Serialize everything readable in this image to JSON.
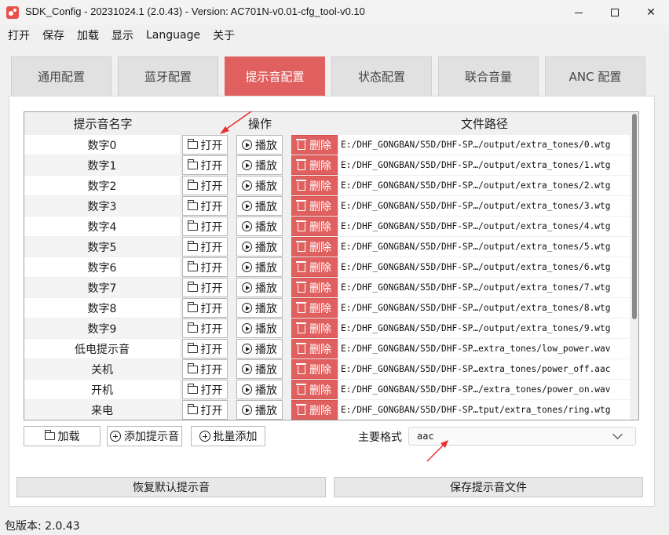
{
  "window": {
    "title": "SDK_Config -  20231024.1  (2.0.43) - Version: AC701N-v0.01-cfg_tool-v0.10"
  },
  "menu": [
    "打开",
    "保存",
    "加载",
    "显示",
    "Language",
    "关于"
  ],
  "tabs": [
    {
      "label": "通用配置",
      "active": false
    },
    {
      "label": "蓝牙配置",
      "active": false
    },
    {
      "label": "提示音配置",
      "active": true
    },
    {
      "label": "状态配置",
      "active": false
    },
    {
      "label": "联合音量",
      "active": false
    },
    {
      "label": "ANC 配置",
      "active": false
    }
  ],
  "table": {
    "headers": {
      "name": "提示音名字",
      "op": "操作",
      "path": "文件路径"
    },
    "open_label": "打开",
    "play_label": "播放",
    "delete_label": "删除",
    "rows": [
      {
        "name": "数字0",
        "path": "E:/DHF_GONGBAN/S5D/DHF-SP…/output/extra_tones/0.wtg"
      },
      {
        "name": "数字1",
        "path": "E:/DHF_GONGBAN/S5D/DHF-SP…/output/extra_tones/1.wtg"
      },
      {
        "name": "数字2",
        "path": "E:/DHF_GONGBAN/S5D/DHF-SP…/output/extra_tones/2.wtg"
      },
      {
        "name": "数字3",
        "path": "E:/DHF_GONGBAN/S5D/DHF-SP…/output/extra_tones/3.wtg"
      },
      {
        "name": "数字4",
        "path": "E:/DHF_GONGBAN/S5D/DHF-SP…/output/extra_tones/4.wtg"
      },
      {
        "name": "数字5",
        "path": "E:/DHF_GONGBAN/S5D/DHF-SP…/output/extra_tones/5.wtg"
      },
      {
        "name": "数字6",
        "path": "E:/DHF_GONGBAN/S5D/DHF-SP…/output/extra_tones/6.wtg"
      },
      {
        "name": "数字7",
        "path": "E:/DHF_GONGBAN/S5D/DHF-SP…/output/extra_tones/7.wtg"
      },
      {
        "name": "数字8",
        "path": "E:/DHF_GONGBAN/S5D/DHF-SP…/output/extra_tones/8.wtg"
      },
      {
        "name": "数字9",
        "path": "E:/DHF_GONGBAN/S5D/DHF-SP…/output/extra_tones/9.wtg"
      },
      {
        "name": "低电提示音",
        "path": "E:/DHF_GONGBAN/S5D/DHF-SP…extra_tones/low_power.wav"
      },
      {
        "name": "关机",
        "path": "E:/DHF_GONGBAN/S5D/DHF-SP…extra_tones/power_off.aac"
      },
      {
        "name": "开机",
        "path": "E:/DHF_GONGBAN/S5D/DHF-SP…/extra_tones/power_on.wav"
      },
      {
        "name": "来电",
        "path": "E:/DHF_GONGBAN/S5D/DHF-SP…tput/extra_tones/ring.wtg"
      }
    ]
  },
  "controls": {
    "load_label": "加载",
    "add_tone_label": "添加提示音",
    "batch_add_label": "批量添加",
    "format_label": "主要格式",
    "format_value": "aac",
    "restore_label": "恢复默认提示音",
    "save_label": "保存提示音文件"
  },
  "status": {
    "version_text": "包版本:  2.0.43"
  },
  "colors": {
    "accent": "#e0605f",
    "annotation": "#e8302a"
  }
}
